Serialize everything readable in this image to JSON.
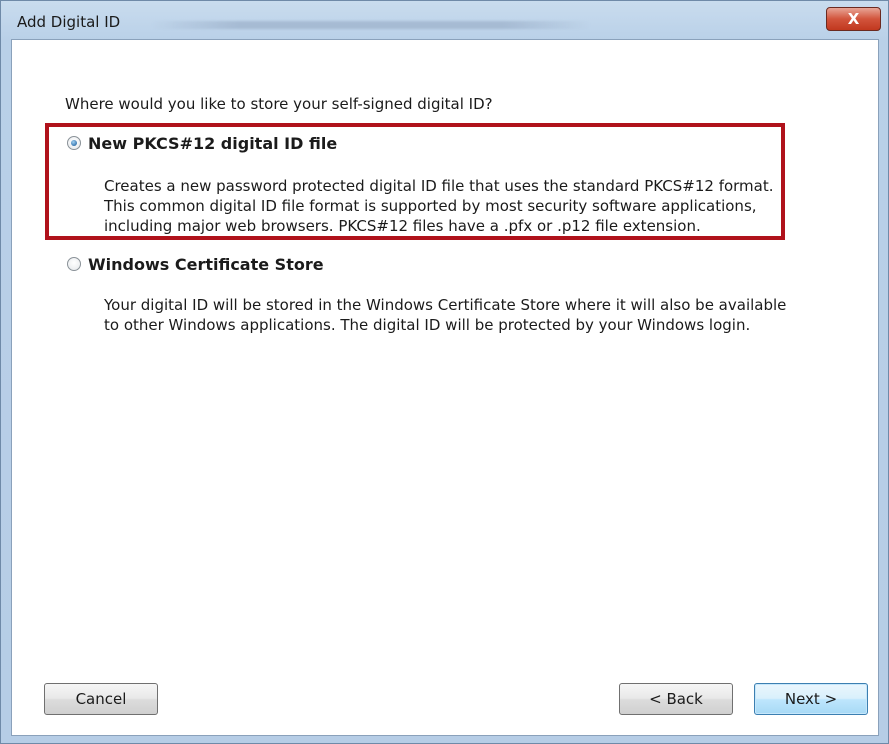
{
  "window": {
    "title": "Add Digital ID",
    "close_glyph": "X"
  },
  "prompt": "Where would you like to store your self-signed digital ID?",
  "options": [
    {
      "label": "New PKCS#12 digital ID file",
      "selected": true,
      "description": [
        "Creates a new password protected digital ID file that uses the standard PKCS#12 format.",
        "This common digital ID file format is supported by most security software applications,",
        "including major web browsers. PKCS#12 files have a .pfx or .p12 file extension."
      ]
    },
    {
      "label": "Windows Certificate Store",
      "selected": false,
      "description": [
        "Your digital ID will be stored in the Windows Certificate Store where it will also be available",
        "to other Windows applications. The digital ID will be protected by your Windows login."
      ]
    }
  ],
  "buttons": {
    "cancel": "Cancel",
    "back": "< Back",
    "next": "Next >"
  },
  "colors": {
    "highlight_border": "#b0121b",
    "close_button": "#c1381f"
  }
}
